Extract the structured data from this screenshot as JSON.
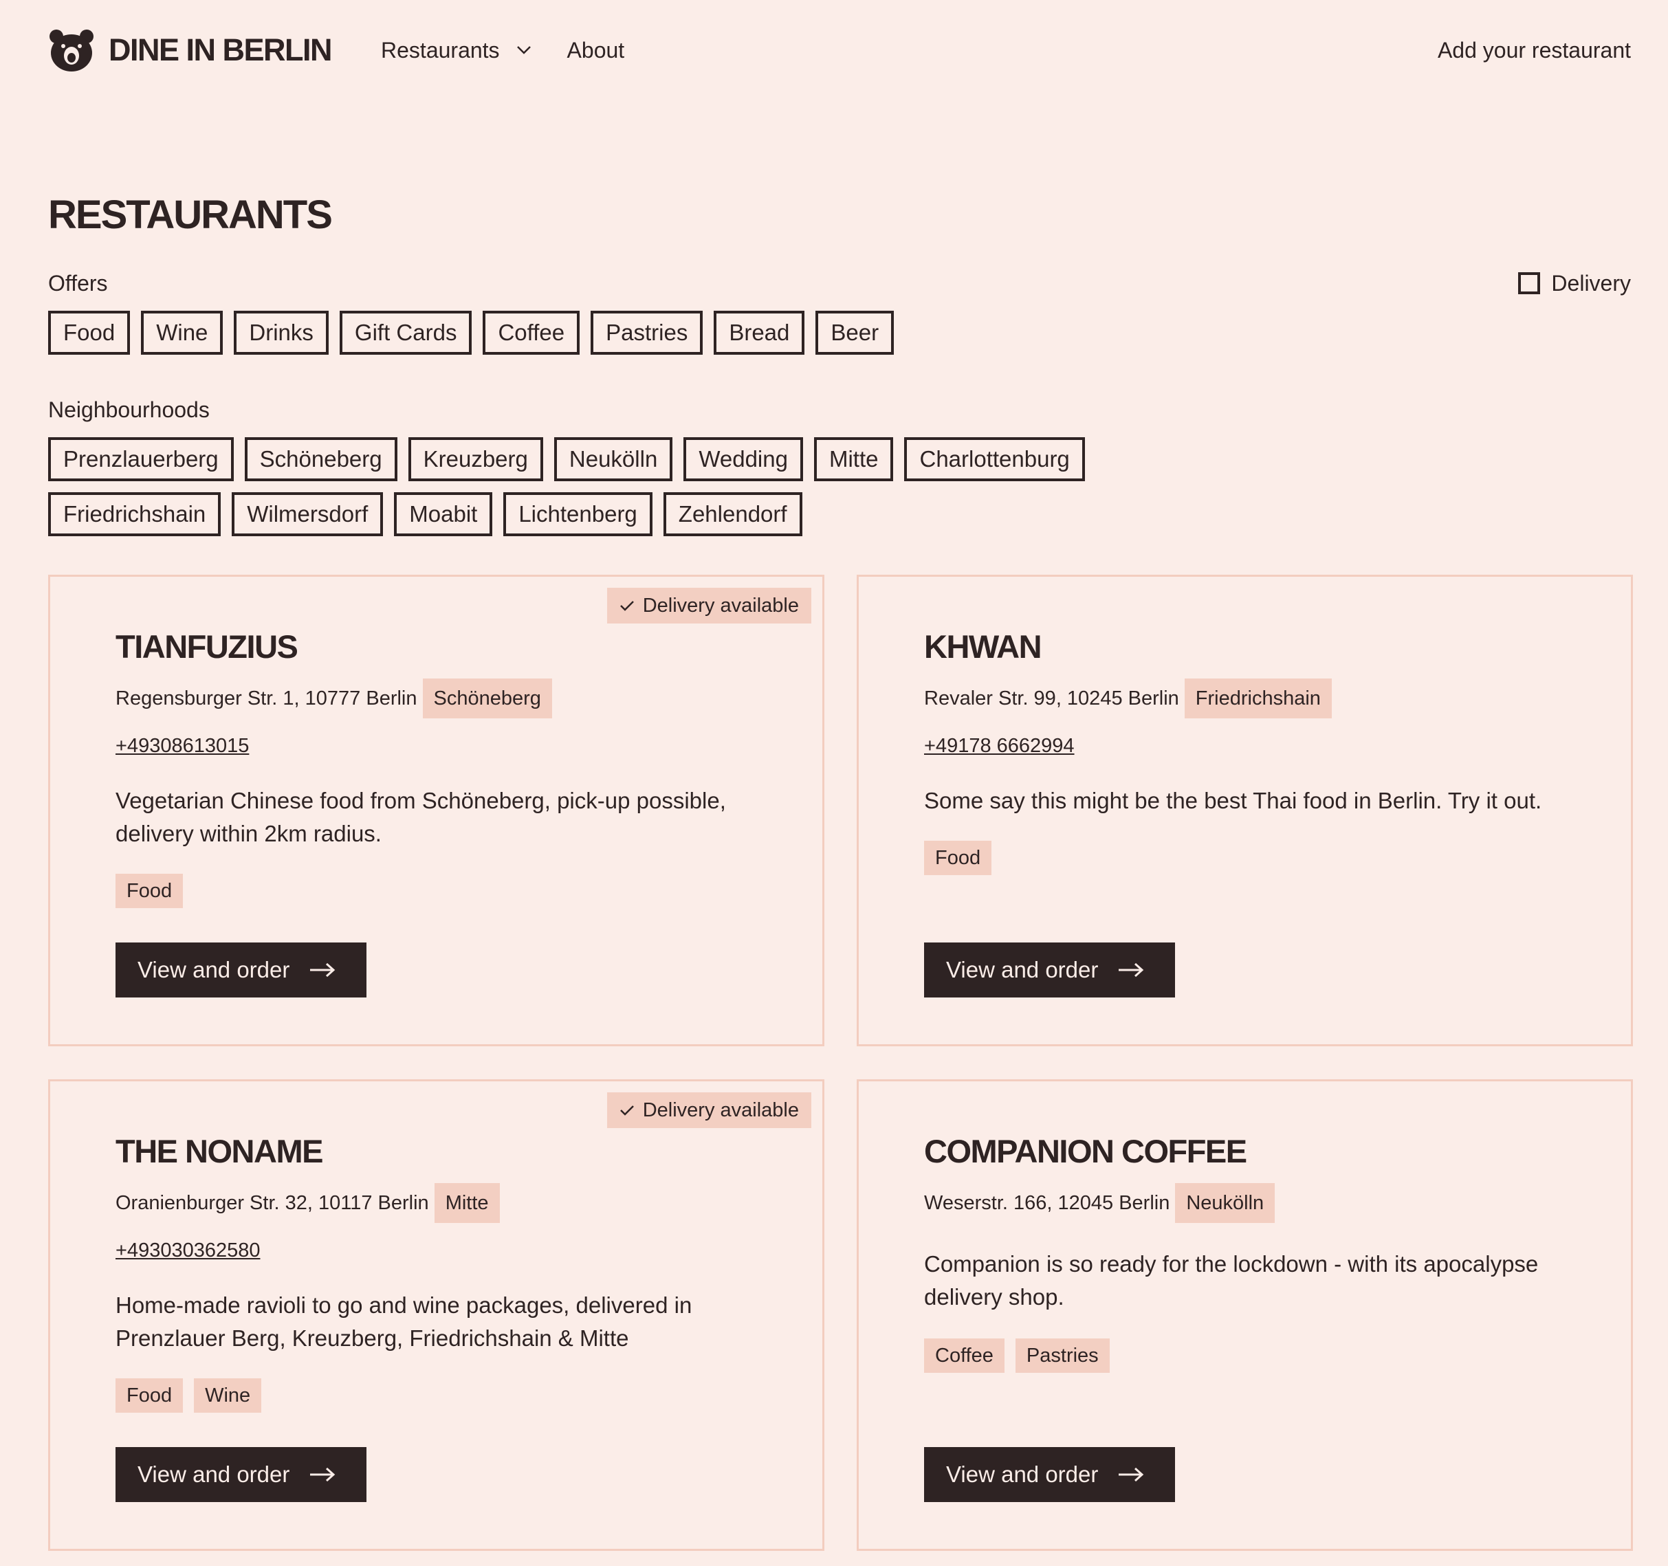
{
  "header": {
    "brand": "DINE IN BERLIN",
    "logo_icon": "bear-head-icon",
    "nav": [
      {
        "label": "Restaurants",
        "has_dropdown": true
      },
      {
        "label": "About"
      }
    ],
    "cta": "Add your restaurant"
  },
  "page": {
    "title": "RESTAURANTS"
  },
  "filters": {
    "offers_label": "Offers",
    "offers": [
      "Food",
      "Wine",
      "Drinks",
      "Gift Cards",
      "Coffee",
      "Pastries",
      "Bread",
      "Beer"
    ],
    "delivery_label": "Delivery",
    "delivery_checked": false,
    "neighbourhoods_label": "Neighbourhoods",
    "neighbourhoods_row1": [
      "Prenzlauerberg",
      "Schöneberg",
      "Kreuzberg",
      "Neukölln",
      "Wedding",
      "Mitte",
      "Charlottenburg"
    ],
    "neighbourhoods_row2": [
      "Friedrichshain",
      "Wilmersdorf",
      "Moabit",
      "Lichtenberg",
      "Zehlendorf"
    ]
  },
  "restaurants": [
    {
      "name": "TIANFUZIUS",
      "address": "Regensburger Str. 1, 10777 Berlin",
      "neighbourhood": "Schöneberg",
      "phone": "+49308613015",
      "description": "Vegetarian Chinese food from Schöneberg, pick-up possible, delivery within 2km radius.",
      "tags": [
        "Food"
      ],
      "delivery_badge": "Delivery available",
      "button": "View and order"
    },
    {
      "name": "KHWAN",
      "address": "Revaler Str. 99, 10245 Berlin",
      "neighbourhood": "Friedrichshain",
      "phone": "+49178 6662994",
      "description": "Some say this might be the best Thai food in Berlin. Try it out.",
      "tags": [
        "Food"
      ],
      "delivery_badge": "",
      "button": "View and order"
    },
    {
      "name": "THE NONAME",
      "address": "Oranienburger Str. 32, 10117 Berlin",
      "neighbourhood": "Mitte",
      "phone": "+493030362580",
      "description": "Home-made ravioli to go and wine packages, delivered in Prenzlauer Berg, Kreuzberg, Friedrichshain & Mitte",
      "tags": [
        "Food",
        "Wine"
      ],
      "delivery_badge": "Delivery available",
      "button": "View and order"
    },
    {
      "name": "COMPANION COFFEE",
      "address": "Weserstr. 166, 12045 Berlin",
      "neighbourhood": "Neukölln",
      "phone": "",
      "description": "Companion is so ready for the lockdown - with its apocalypse delivery shop.",
      "tags": [
        "Coffee",
        "Pastries"
      ],
      "delivery_badge": "",
      "button": "View and order"
    }
  ],
  "icons": {
    "dropdown": "chevron-down-icon",
    "badge_check": "check-icon",
    "button_arrow": "arrow-right-icon",
    "delivery_checkbox": "checkbox-icon"
  },
  "colors": {
    "background": "#fbede8",
    "text": "#2e2323",
    "tag_bg": "#f3cfc2",
    "card_border": "#f3cdbf",
    "button_bg": "#2e2323",
    "button_text": "#fbede8"
  }
}
